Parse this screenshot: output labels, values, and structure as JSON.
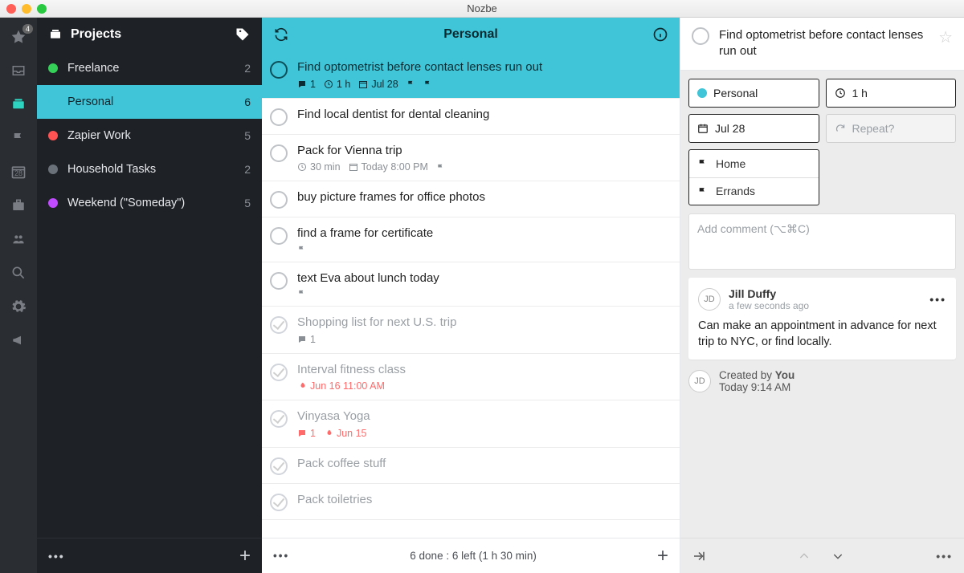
{
  "window": {
    "title": "Nozbe"
  },
  "rail": {
    "badge": "4"
  },
  "sidebar": {
    "title": "Projects",
    "items": [
      {
        "name": "Freelance",
        "count": "2",
        "color": "#34d058"
      },
      {
        "name": "Personal",
        "count": "6",
        "color": "#3fc5d7",
        "active": true
      },
      {
        "name": "Zapier Work",
        "count": "5",
        "color": "#ff5252"
      },
      {
        "name": "Household Tasks",
        "count": "2",
        "color": "#6b7179"
      },
      {
        "name": "Weekend (\"Someday\")",
        "count": "5",
        "color": "#c04bff"
      }
    ]
  },
  "center": {
    "title": "Personal",
    "tasks": [
      {
        "name": "Find optometrist before contact lenses run out",
        "selected": true,
        "meta": [
          {
            "icon": "comment",
            "text": "1"
          },
          {
            "icon": "clock",
            "text": "1 h"
          },
          {
            "icon": "cal",
            "text": "Jul 28"
          },
          {
            "icon": "flag"
          },
          {
            "icon": "flag"
          }
        ]
      },
      {
        "name": "Find local dentist for dental cleaning"
      },
      {
        "name": "Pack for Vienna trip",
        "meta": [
          {
            "icon": "clock",
            "text": "30 min"
          },
          {
            "icon": "cal",
            "text": "Today 8:00 PM"
          },
          {
            "icon": "flag"
          }
        ]
      },
      {
        "name": "buy picture frames for office photos"
      },
      {
        "name": "find a frame for certificate",
        "meta": [
          {
            "icon": "flag"
          }
        ]
      },
      {
        "name": "text Eva about lunch today",
        "meta": [
          {
            "icon": "flag"
          }
        ]
      },
      {
        "name": "Shopping list for next U.S. trip",
        "done": true,
        "meta": [
          {
            "icon": "comment",
            "text": "1"
          }
        ]
      },
      {
        "name": "Interval fitness class",
        "done": true,
        "meta_red": true,
        "meta": [
          {
            "icon": "fire",
            "text": "Jun 16 11:00 AM"
          }
        ]
      },
      {
        "name": "Vinyasa Yoga",
        "done": true,
        "meta_red": true,
        "meta": [
          {
            "icon": "comment",
            "text": "1"
          },
          {
            "icon": "fire",
            "text": "Jun 15"
          }
        ]
      },
      {
        "name": "Pack coffee stuff",
        "done": true
      },
      {
        "name": "Pack toiletries",
        "done": true
      }
    ],
    "footer_summary": "6 done  :  6 left (1 h 30 min)"
  },
  "detail": {
    "title": "Find optometrist before contact lenses run out",
    "project": "Personal",
    "duration": "1 h",
    "date": "Jul 28",
    "repeat": "Repeat?",
    "contexts": [
      "Home",
      "Errands"
    ],
    "comment_placeholder": "Add comment (⌥⌘C)",
    "comment": {
      "avatar": "JD",
      "author": "Jill Duffy",
      "time": "a few seconds ago",
      "body": "Can make an appointment in advance for next trip to NYC, or find locally."
    },
    "created": {
      "avatar": "JD",
      "line1_prefix": "Created by ",
      "line1_bold": "You",
      "line2": "Today 9:14 AM"
    }
  }
}
